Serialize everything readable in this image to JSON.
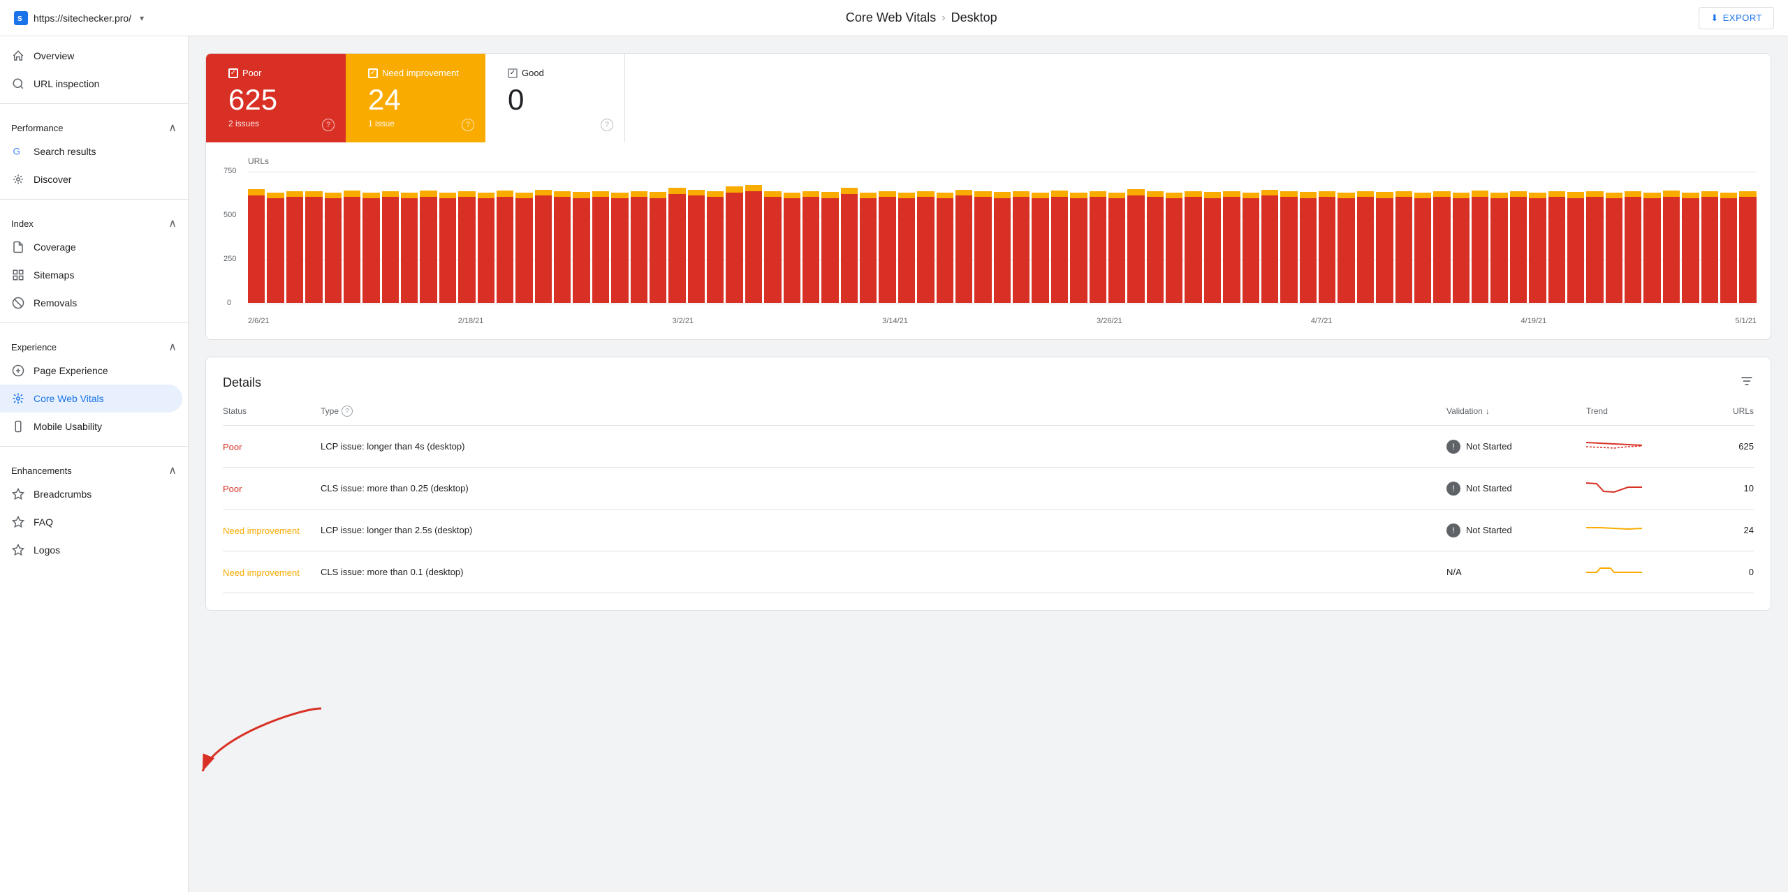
{
  "topbar": {
    "site_icon": "S",
    "site_url": "https://sitechecker.pro/",
    "breadcrumb_parent": "Core Web Vitals",
    "breadcrumb_sep": ">",
    "breadcrumb_current": "Desktop",
    "export_label": "EXPORT"
  },
  "sidebar": {
    "overview": "Overview",
    "url_inspection": "URL inspection",
    "sections": {
      "performance": {
        "label": "Performance",
        "items": [
          "Search results",
          "Discover"
        ]
      },
      "index": {
        "label": "Index",
        "items": [
          "Coverage",
          "Sitemaps",
          "Removals"
        ]
      },
      "experience": {
        "label": "Experience",
        "items": [
          "Page Experience",
          "Core Web Vitals",
          "Mobile Usability"
        ]
      },
      "enhancements": {
        "label": "Enhancements",
        "items": [
          "Breadcrumbs",
          "FAQ",
          "Logos"
        ]
      }
    }
  },
  "status_cards": {
    "poor": {
      "label": "Poor",
      "count": "625",
      "issues": "2 issues"
    },
    "need_improvement": {
      "label": "Need improvement",
      "count": "24",
      "issues": "1 issue"
    },
    "good": {
      "label": "Good",
      "count": "0"
    }
  },
  "chart": {
    "y_label": "URLs",
    "y_values": [
      "750",
      "500",
      "250",
      "0"
    ],
    "x_labels": [
      "2/6/21",
      "2/18/21",
      "3/2/21",
      "3/14/21",
      "3/26/21",
      "4/7/21",
      "4/19/21",
      "5/1/21"
    ]
  },
  "details": {
    "title": "Details",
    "columns": {
      "status": "Status",
      "type": "Type",
      "type_help": "?",
      "validation": "Validation",
      "trend": "Trend",
      "urls": "URLs"
    },
    "rows": [
      {
        "status": "Poor",
        "status_type": "poor",
        "type": "LCP issue: longer than 4s (desktop)",
        "validation": "Not Started",
        "urls": "625"
      },
      {
        "status": "Poor",
        "status_type": "poor",
        "type": "CLS issue: more than 0.25 (desktop)",
        "validation": "Not Started",
        "urls": "10"
      },
      {
        "status": "Need improvement",
        "status_type": "need",
        "type": "LCP issue: longer than 2.5s (desktop)",
        "validation": "Not Started",
        "urls": "24"
      },
      {
        "status": "Need improvement",
        "status_type": "need",
        "type": "CLS issue: more than 0.1 (desktop)",
        "validation": "N/A",
        "urls": "0"
      }
    ]
  },
  "colors": {
    "poor": "#d93025",
    "need": "#f9ab00",
    "good": "#188038",
    "active_nav": "#1a73e8"
  }
}
